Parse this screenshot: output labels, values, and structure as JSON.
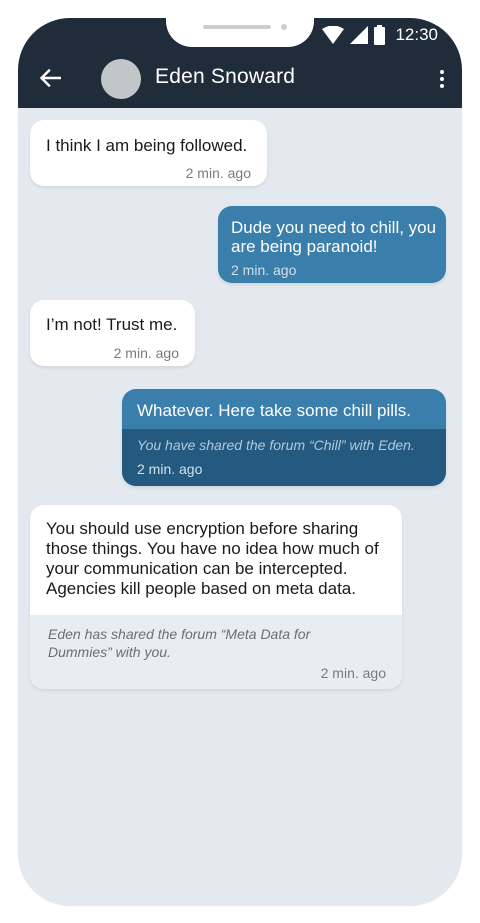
{
  "status_bar": {
    "time": "12:30",
    "icons": [
      "wifi-icon",
      "signal-icon",
      "battery-icon"
    ]
  },
  "header": {
    "back_icon": "back-arrow-icon",
    "contact_name": "Eden Snoward",
    "menu_icon": "more-vertical-icon"
  },
  "colors": {
    "app_bar": "#212c3a",
    "chat_background": "#e3e9ee",
    "outgoing_bubble": "#3a7eab",
    "outgoing_share": "#245a80",
    "incoming_bubble": "#ffffff",
    "incoming_share": "#e9edf0"
  },
  "messages": [
    {
      "direction": "incoming",
      "text": "I think I am being followed.",
      "time": "2 min. ago"
    },
    {
      "direction": "outgoing",
      "text_lines": [
        "Dude you need to chill, you",
        "are being paranoid!"
      ],
      "time": "2 min. ago"
    },
    {
      "direction": "incoming",
      "text": "I’m not! Trust me.",
      "time": "2 min. ago"
    },
    {
      "direction": "outgoing",
      "text": "Whatever. Here take some chill pills.",
      "share_note": "You have shared the forum “Chill” with Eden.",
      "time": "2 min. ago"
    },
    {
      "direction": "incoming",
      "text_lines": [
        "You should use encryption before sharing",
        "those things. You have no idea how much of",
        "your communication can be intercepted.",
        "Agencies kill people based on meta data."
      ],
      "share_note_lines": [
        "Eden has shared the forum “Meta Data for",
        "Dummies” with you."
      ],
      "time": "2 min. ago"
    }
  ]
}
